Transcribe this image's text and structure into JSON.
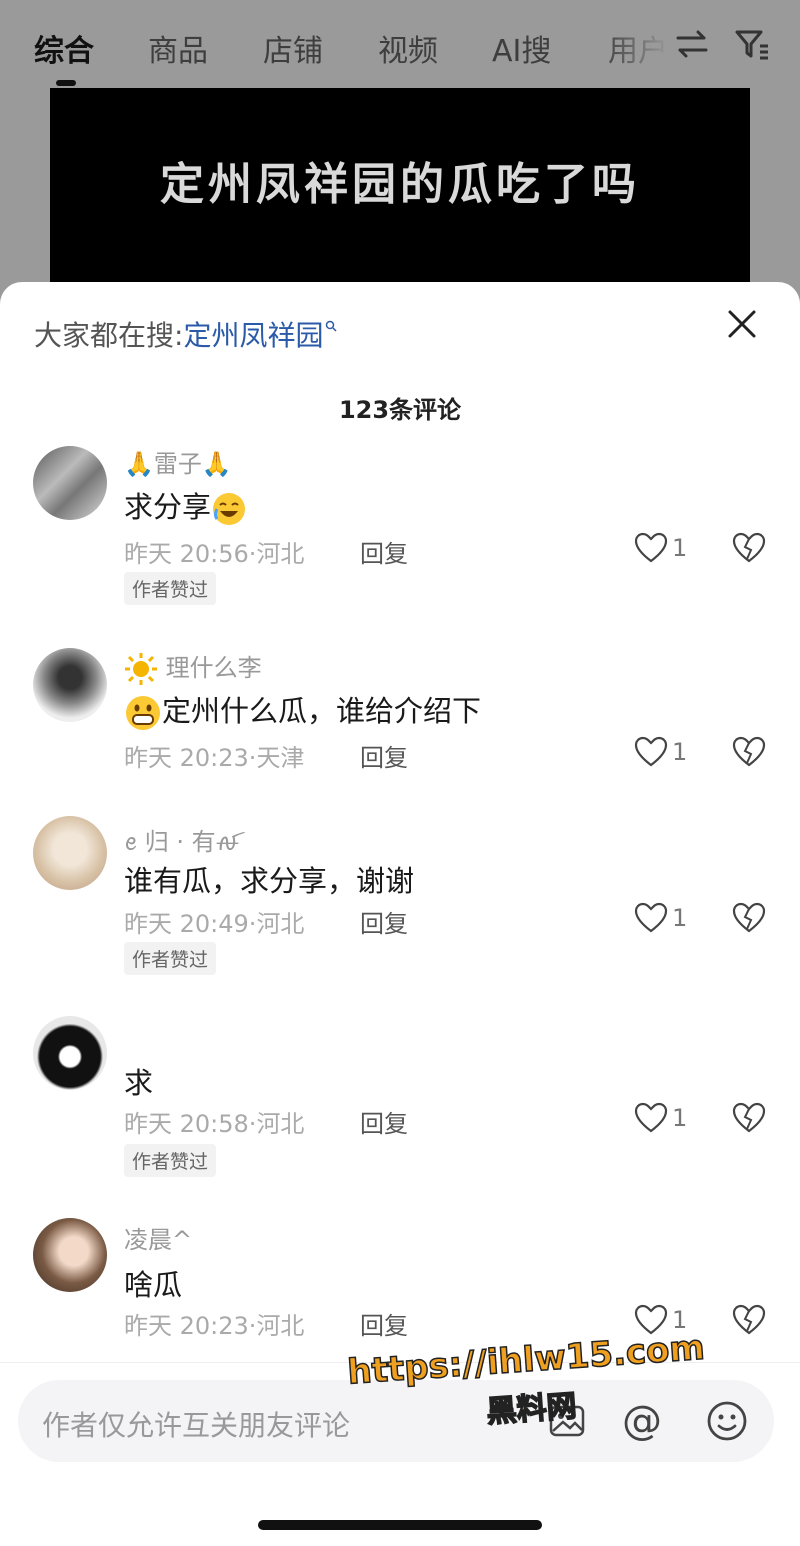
{
  "tabs": [
    "综合",
    "商品",
    "店铺",
    "视频",
    "AI搜",
    "用户"
  ],
  "video": {
    "title": "定州凤祥园的瓜吃了吗"
  },
  "sheet": {
    "hot_search_prefix": "大家都在搜:",
    "hot_search_keyword": "定州凤祥园",
    "comment_count": "123条评论"
  },
  "comments": [
    {
      "user": "🙏雷子🙏",
      "text": "求分享",
      "time": "昨天 20:56",
      "location": "河北",
      "reply": "回复",
      "badge": "作者赞过",
      "likes": "1"
    },
    {
      "user": "理什么李",
      "text": "定州什么瓜，谁给介绍下",
      "time": "昨天 20:23",
      "location": "天津",
      "reply": "回复",
      "likes": "1"
    },
    {
      "user": "ꫀ 归 · 有ꫛ",
      "text": "谁有瓜，求分享，谢谢",
      "time": "昨天 20:49",
      "location": "河北",
      "reply": "回复",
      "badge": "作者赞过",
      "likes": "1"
    },
    {
      "user": "",
      "text": "求",
      "time": "昨天 20:58",
      "location": "河北",
      "reply": "回复",
      "badge": "作者赞过",
      "likes": "1"
    },
    {
      "user": "凌晨^",
      "text": "啥瓜",
      "time": "昨天 20:23",
      "location": "河北",
      "reply": "回复",
      "likes": "1"
    }
  ],
  "input": {
    "placeholder": "作者仅允许互关朋友评论"
  },
  "watermark": {
    "url": "https://ihlw15.com",
    "name": "黑料网"
  },
  "colors": {
    "keyword": "#2b5aa8",
    "watermark": "#f0a020"
  }
}
